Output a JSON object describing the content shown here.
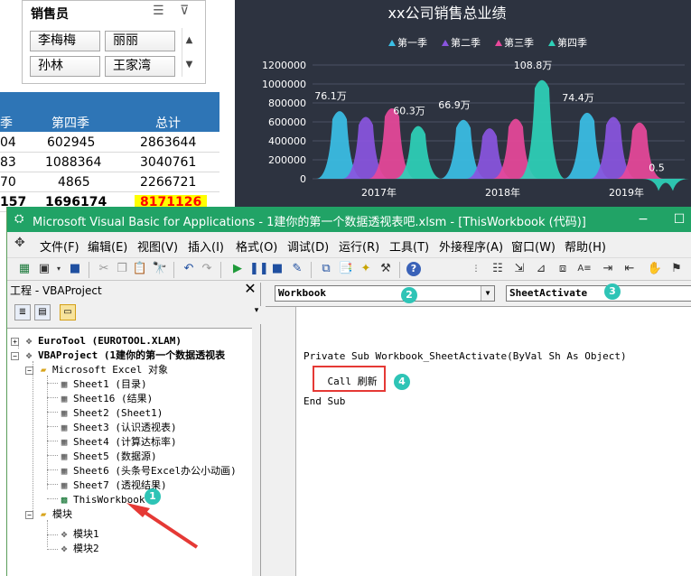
{
  "slicer": {
    "title": "销售员",
    "items": [
      "李梅梅",
      "丽丽",
      "孙林",
      "王家湾"
    ],
    "icons": [
      "multi-select-icon",
      "clear-filter-icon"
    ]
  },
  "sheet": {
    "headers": [
      "季",
      "第四季",
      "总计"
    ],
    "rows": [
      [
        "04",
        "602945",
        "2863644"
      ],
      [
        "83",
        "1088364",
        "3040761"
      ],
      [
        "70",
        "4865",
        "2266721"
      ]
    ],
    "total": [
      "157",
      "1696174",
      "8171126"
    ]
  },
  "chart_data": {
    "type": "area",
    "title": "xx公司销售总业绩",
    "legend": [
      "第一季",
      "第二季",
      "第三季",
      "第四季"
    ],
    "legend_position": "top",
    "colors": [
      "#3bbfe6",
      "#8a55e0",
      "#e8489a",
      "#2ed1b8"
    ],
    "categories": [
      "2017年",
      "2018年",
      "2019年"
    ],
    "series": [
      {
        "name": "第一季",
        "values": [
          761000,
          669000,
          744000
        ]
      },
      {
        "name": "第二季",
        "values": [
          700000,
          580000,
          700000
        ]
      },
      {
        "name": "第三季",
        "values": [
          790000,
          680000,
          640000
        ]
      },
      {
        "name": "第四季",
        "values": [
          603000,
          1088000,
          5000
        ]
      }
    ],
    "data_labels": [
      "76.1万",
      "60.3万",
      "66.9万",
      "108.8万",
      "74.4万",
      "0.5"
    ],
    "yticks": [
      "1200000",
      "1000000",
      "800000",
      "600000",
      "400000",
      "200000",
      "0"
    ],
    "ylim": [
      0,
      1200000
    ],
    "grid": true
  },
  "vba": {
    "title": "Microsoft Visual Basic for Applications - 1建你的第一个数据透视表吧.xlsm - [ThisWorkbook (代码)]",
    "window_buttons": [
      "−",
      "☐"
    ],
    "menu": [
      "文件(F)",
      "编辑(E)",
      "视图(V)",
      "插入(I)",
      "格式(O)",
      "调试(D)",
      "运行(R)",
      "工具(T)",
      "外接程序(A)",
      "窗口(W)",
      "帮助(H)"
    ],
    "project_explorer": {
      "title": "工程 - VBAProject",
      "close": "✕",
      "tree": [
        {
          "label": "EuroTool (EUROTOOL.XLAM)",
          "bold": true
        },
        {
          "label": "VBAProject (1建你的第一个数据透视表",
          "bold": true
        },
        {
          "label": "Microsoft Excel 对象"
        },
        {
          "label": "Sheet1 (目录)"
        },
        {
          "label": "Sheet16 (结果)"
        },
        {
          "label": "Sheet2 (Sheet1)"
        },
        {
          "label": "Sheet3 (认识透视表)"
        },
        {
          "label": "Sheet4 (计算达标率)"
        },
        {
          "label": "Sheet5 (数据源)"
        },
        {
          "label": "Sheet6 (头条号Excel办公小动画)"
        },
        {
          "label": "Sheet7 (透视结果)"
        },
        {
          "label": "ThisWorkbook"
        },
        {
          "label": "模块"
        },
        {
          "label": "模块1"
        },
        {
          "label": "模块2"
        }
      ]
    },
    "object_combo": "Workbook",
    "procedure_combo": "SheetActivate",
    "code": [
      "Private Sub Workbook_SheetActivate(ByVal Sh As Object)",
      "    Call 刷新",
      "End Sub"
    ],
    "badges": [
      "1",
      "2",
      "3",
      "4"
    ]
  }
}
